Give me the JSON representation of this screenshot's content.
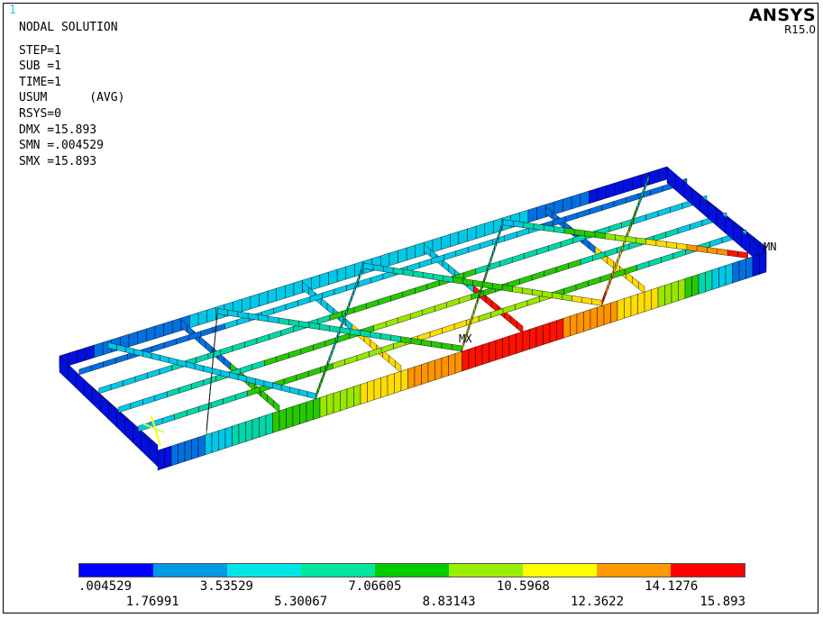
{
  "window_number": "1",
  "brand": {
    "name": "ANSYS",
    "version": "R15.0"
  },
  "info": {
    "title": "NODAL SOLUTION",
    "lines": [
      "STEP=1",
      "SUB =1",
      "TIME=1",
      "USUM      (AVG)",
      "RSYS=0",
      "DMX =15.893",
      "SMN =.004529",
      "SMX =15.893"
    ]
  },
  "markers": {
    "min": "MN",
    "max": "MX"
  },
  "legend": {
    "colors": [
      "#0000ff",
      "#0099e6",
      "#00e6e6",
      "#00e6a0",
      "#00cc00",
      "#99ee00",
      "#ffff00",
      "#ff9900",
      "#ff0000"
    ],
    "top_labels": [
      ".004529",
      "3.53529",
      "7.06605",
      "10.5968",
      "14.1276"
    ],
    "bottom_labels": [
      "1.76991",
      "5.30067",
      "8.83143",
      "12.3622",
      "15.893"
    ]
  },
  "model": {
    "description": "contour of beam frame",
    "frame_colors": [
      "#0010e0",
      "#0070e0",
      "#00c8e6",
      "#00d6a8",
      "#28c800",
      "#9ae600",
      "#ffdd00",
      "#ff9400",
      "#ff1200"
    ]
  }
}
